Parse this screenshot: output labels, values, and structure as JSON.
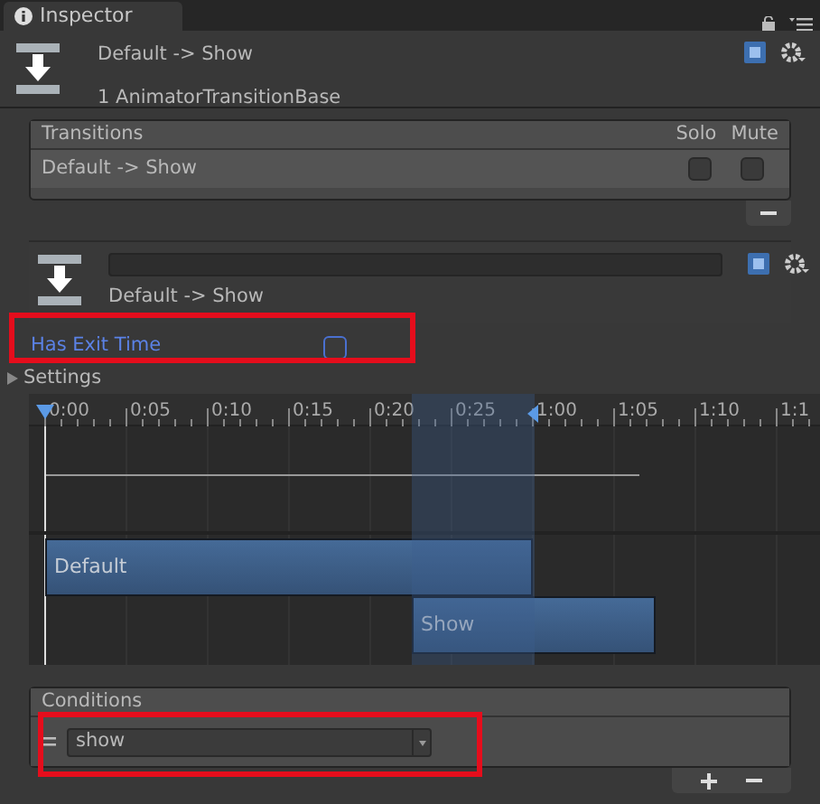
{
  "tab": {
    "title": "Inspector"
  },
  "header": {
    "title": "Default -> Show",
    "subtitle": "1 AnimatorTransitionBase"
  },
  "transitions": {
    "columns": [
      "Transitions",
      "Solo",
      "Mute"
    ],
    "rows": [
      {
        "name": "Default -> Show",
        "solo": false,
        "mute": false
      }
    ]
  },
  "transition": {
    "subtitle": "Default -> Show"
  },
  "has_exit_time": {
    "label": "Has Exit Time",
    "checked": false
  },
  "settings": {
    "label": "Settings",
    "expanded": false
  },
  "timeline": {
    "ticks": [
      "0:00",
      "0:05",
      "0:10",
      "0:15",
      "0:20",
      "0:25",
      "1:00",
      "1:05",
      "1:10",
      "1:1"
    ],
    "states": [
      {
        "label": "Default"
      },
      {
        "label": "Show"
      }
    ]
  },
  "conditions": {
    "title": "Conditions",
    "items": [
      {
        "parameter": "show"
      }
    ]
  }
}
